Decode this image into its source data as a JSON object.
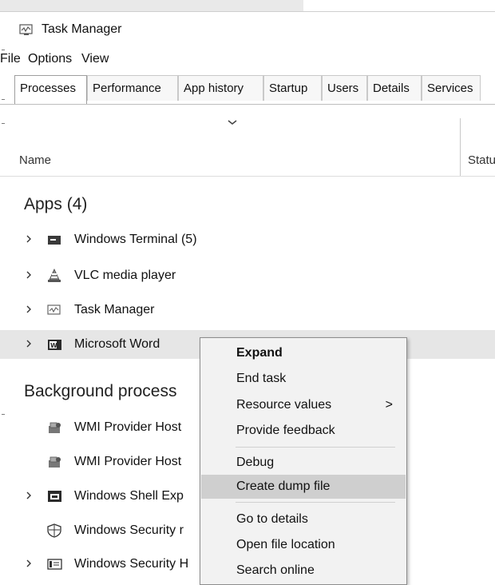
{
  "window": {
    "title": "Task Manager",
    "icon": "task-manager-icon"
  },
  "menu": [
    "File",
    "Options",
    "View"
  ],
  "tabs": [
    "Processes",
    "Performance",
    "App history",
    "Startup",
    "Users",
    "Details",
    "Services"
  ],
  "active_tab": "Processes",
  "columns": {
    "name": "Name",
    "status": "Statu"
  },
  "groups": {
    "apps": "Apps (4)",
    "background": "Background process"
  },
  "apps": [
    {
      "label": "Windows Terminal (5)",
      "icon": "windows-terminal-icon"
    },
    {
      "label": "VLC media player",
      "icon": "vlc-icon"
    },
    {
      "label": "Task Manager",
      "icon": "task-manager-icon"
    },
    {
      "label": "Microsoft Word",
      "icon": "word-icon"
    }
  ],
  "background": [
    {
      "label": "WMI Provider Host",
      "icon": "wmi-icon"
    },
    {
      "label": "WMI Provider Host",
      "icon": "wmi-icon"
    },
    {
      "label": "Windows Shell Exp",
      "icon": "window-app-icon"
    },
    {
      "label": "Windows Security r",
      "icon": "shield-icon"
    },
    {
      "label": "Windows Security H",
      "icon": "window-app-icon"
    }
  ],
  "context_menu": {
    "items": [
      {
        "label": "Expand",
        "bold": true
      },
      {
        "label": "End task"
      },
      {
        "label": "Resource values",
        "submenu": ">"
      },
      {
        "label": "Provide feedback"
      },
      {
        "label": "Debug"
      },
      {
        "label": "Create dump file",
        "highlighted": true
      },
      {
        "label": "Go to details"
      },
      {
        "label": "Open file location"
      },
      {
        "label": "Search online"
      }
    ]
  },
  "colors": {
    "row_highlight": "#e6e6e6",
    "menu_bg": "#f2f2f2",
    "menu_hover": "#cfcfcf"
  }
}
